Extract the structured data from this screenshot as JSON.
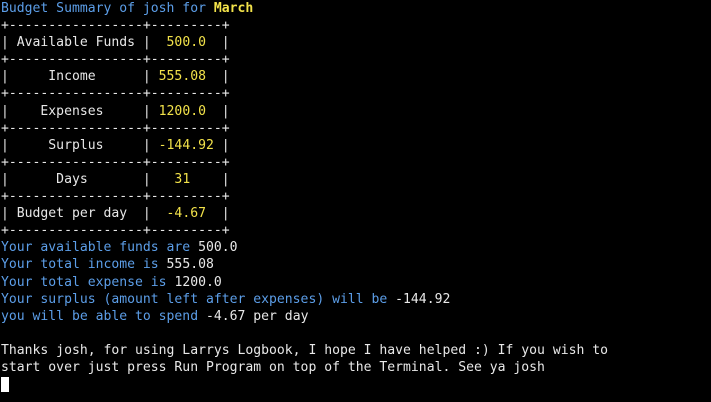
{
  "header": {
    "prefix": "Budget Summary of josh for ",
    "month": "March"
  },
  "table": {
    "border": "+-----------------+---------+",
    "rows": [
      {
        "label": "| Available Funds |",
        "value": "  500.0  ",
        "end": "|"
      },
      {
        "label": "|     Income      |",
        "value": " 555.08  ",
        "end": "|"
      },
      {
        "label": "|    Expenses     |",
        "value": " 1200.0  ",
        "end": "|"
      },
      {
        "label": "|     Surplus     |",
        "value": " -144.92 ",
        "end": "|"
      },
      {
        "label": "|      Days       |",
        "value": "   31    ",
        "end": "|"
      },
      {
        "label": "| Budget per day  |",
        "value": "  -4.67  ",
        "end": "|"
      }
    ]
  },
  "summary": [
    {
      "text": "Your available funds are ",
      "value": "500.0",
      "suffix": ""
    },
    {
      "text": "Your total income is ",
      "value": "555.08",
      "suffix": ""
    },
    {
      "text": "Your total expense is ",
      "value": "1200.0",
      "suffix": ""
    },
    {
      "text": "Your surplus (amount left after expenses) will be ",
      "value": "-144.92",
      "suffix": ""
    },
    {
      "text": "you will be able to spend ",
      "value": "-4.67",
      "suffix": " per day"
    }
  ],
  "closing": {
    "line1": "Thanks josh, for using Larrys Logbook, I hope I have helped :) If you wish to",
    "line2": "start over just press Run Program on top of the Terminal. See ya josh"
  },
  "colors": {
    "prompt_blue": "#5c9ee8",
    "value_yellow": "#f2e24a",
    "text_white": "#e8e8e8",
    "background": "#000000"
  }
}
